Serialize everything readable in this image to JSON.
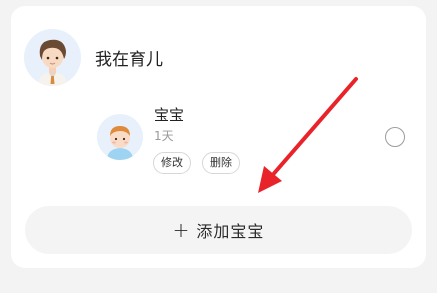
{
  "parent": {
    "avatar_icon": "boy-avatar-icon",
    "name": "我在育儿"
  },
  "baby": {
    "avatar_icon": "baby-avatar-icon",
    "name": "宝宝",
    "age": "1天",
    "edit_label": "修改",
    "delete_label": "删除",
    "selected": false
  },
  "add_button": {
    "icon": "plus-icon",
    "plus": "+",
    "label": "添加宝宝"
  },
  "annotation": {
    "icon": "red-arrow-icon",
    "color": "#e8242a"
  }
}
